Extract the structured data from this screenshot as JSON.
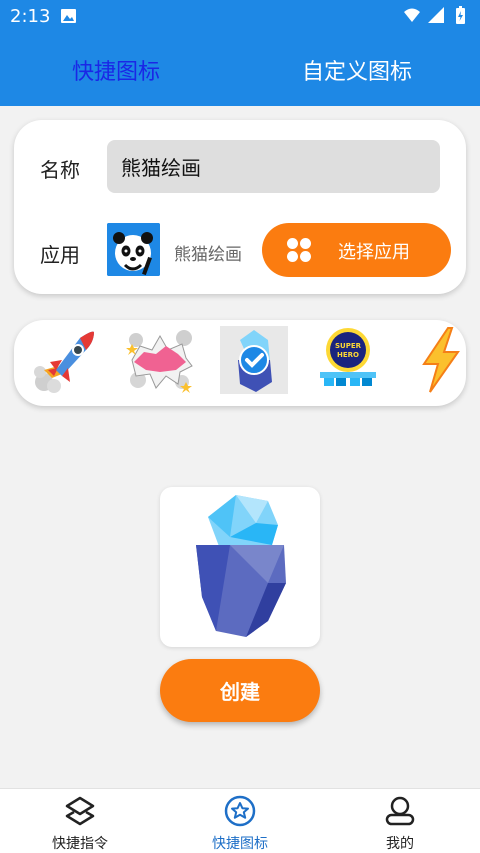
{
  "status_bar": {
    "time": "2:13"
  },
  "top_tabs": [
    {
      "label": "快捷图标",
      "active": true
    },
    {
      "label": "自定义图标",
      "active": false
    }
  ],
  "form": {
    "name_label": "名称",
    "name_value": "熊猫绘画",
    "app_label": "应用",
    "app_name": "熊猫绘画",
    "select_app_button": "选择应用"
  },
  "stickers": [
    "rocket-icon",
    "bang-icon",
    "iceberg-check-icon",
    "superhero-icon",
    "lightning-icon"
  ],
  "create_button": "创建",
  "bottom_nav": [
    {
      "label": "快捷指令",
      "icon": "shortcut-icon",
      "active": false
    },
    {
      "label": "快捷图标",
      "icon": "star-badge-icon",
      "active": true
    },
    {
      "label": "我的",
      "icon": "profile-icon",
      "active": false
    }
  ],
  "colors": {
    "primary": "#1e88e5",
    "accent": "#fb7c10",
    "active_tab": "#1a27e6"
  }
}
